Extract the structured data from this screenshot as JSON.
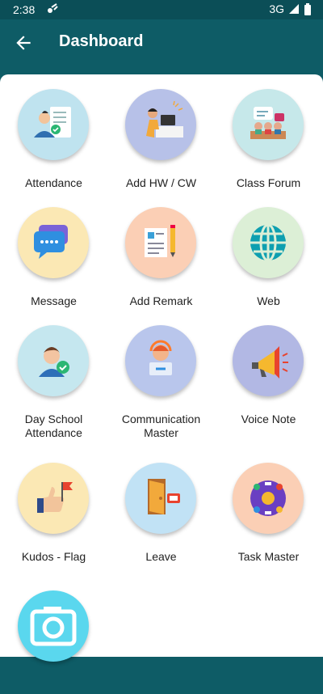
{
  "status_bar": {
    "time": "2:38",
    "network": "3G"
  },
  "app_bar": {
    "title": "Dashboard"
  },
  "tiles": [
    {
      "label": "Attendance",
      "icon": "attendance-icon",
      "bg": "#bfe3ef"
    },
    {
      "label": "Add HW / CW",
      "icon": "homework-icon",
      "bg": "#b7c1e8"
    },
    {
      "label": "Class Forum",
      "icon": "class-forum-icon",
      "bg": "#c6e8ea"
    },
    {
      "label": "Message",
      "icon": "message-icon",
      "bg": "#fbe8b4"
    },
    {
      "label": "Add Remark",
      "icon": "remark-icon",
      "bg": "#fbcfb5"
    },
    {
      "label": "Web",
      "icon": "globe-icon",
      "bg": "#dcefd6"
    },
    {
      "label": "Day School\nAttendance",
      "icon": "day-school-attendance-icon",
      "bg": "#c5e7ef"
    },
    {
      "label": "Communication\nMaster",
      "icon": "communication-icon",
      "bg": "#b9c6ec"
    },
    {
      "label": "Voice Note",
      "icon": "megaphone-icon",
      "bg": "#b2b8e4"
    },
    {
      "label": "Kudos - Flag",
      "icon": "kudos-flag-icon",
      "bg": "#fbe8b4"
    },
    {
      "label": "Leave",
      "icon": "leave-icon",
      "bg": "#c1e2f5"
    },
    {
      "label": "Task Master",
      "icon": "task-master-icon",
      "bg": "#fbcfb5"
    },
    {
      "label": "",
      "icon": "camera-icon",
      "bg": "#5ad7ee"
    }
  ]
}
